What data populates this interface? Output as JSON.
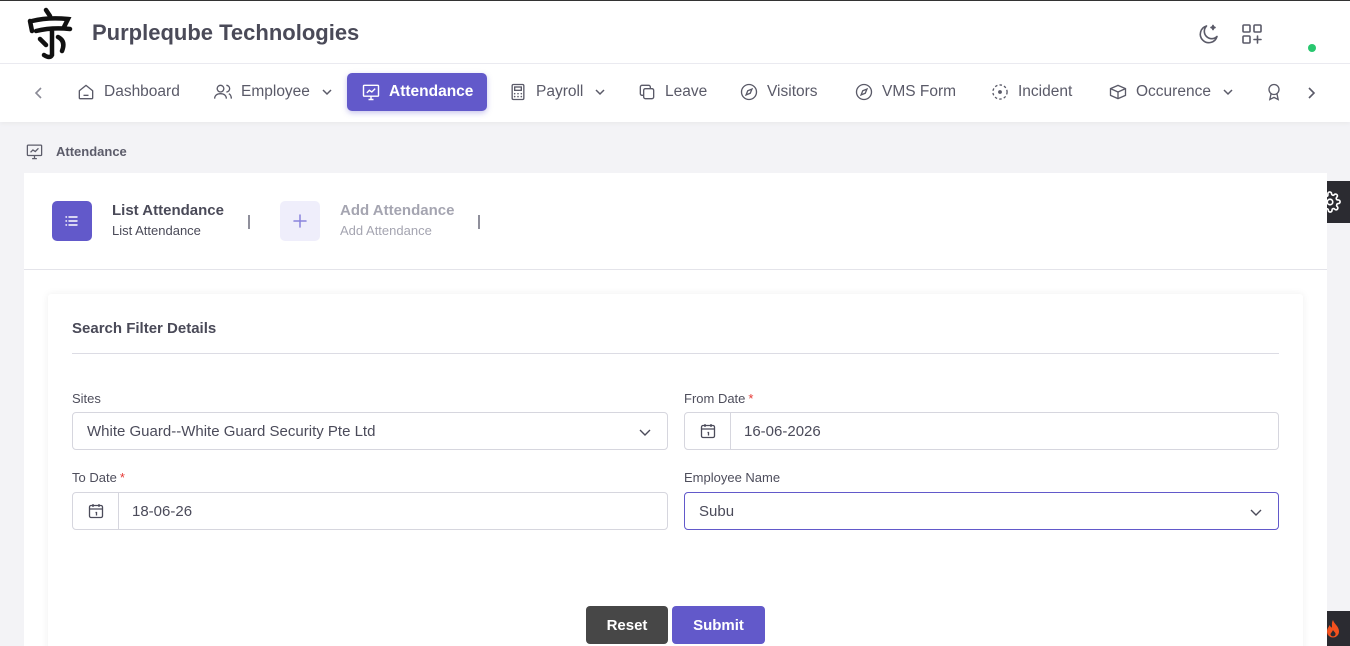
{
  "header": {
    "brand": "Purpleqube Technologies",
    "logo": "brand-logo-seal",
    "icons": [
      "moon-icon",
      "apps-add-icon"
    ],
    "status_color": "#28c76f"
  },
  "nav": {
    "items": [
      {
        "label": "Dashboard",
        "icon": "home-icon"
      },
      {
        "label": "Employee",
        "icon": "users-icon",
        "dropdown": true
      },
      {
        "label": "Attendance",
        "icon": "monitor-chart-icon",
        "active": true
      },
      {
        "label": "Payroll",
        "icon": "calculator-icon",
        "dropdown": true
      },
      {
        "label": "Leave",
        "icon": "copy-icon"
      },
      {
        "label": "Visitors",
        "icon": "compass-icon"
      },
      {
        "label": "VMS Form",
        "icon": "compass-icon"
      },
      {
        "label": "Incident",
        "icon": "focus-icon"
      },
      {
        "label": "Occurence",
        "icon": "box-icon",
        "dropdown": true
      }
    ],
    "accent": "#6259ca"
  },
  "breadcrumb": {
    "label": "Attendance"
  },
  "tabs": [
    {
      "title": "List Attendance",
      "subtitle": "List Attendance",
      "active": true
    },
    {
      "title": "Add Attendance",
      "subtitle": "Add Attendance",
      "active": false
    }
  ],
  "filter": {
    "title": "Search Filter Details",
    "sites_label": "Sites",
    "sites_value": "White Guard--White Guard Security Pte Ltd",
    "from_label": "From Date",
    "from_value": "16-06-2026",
    "to_label": "To Date",
    "to_value": "18-06-26",
    "employee_label": "Employee Name",
    "employee_value": "Subu",
    "required_mark": "*",
    "reset_label": "Reset",
    "submit_label": "Submit"
  }
}
